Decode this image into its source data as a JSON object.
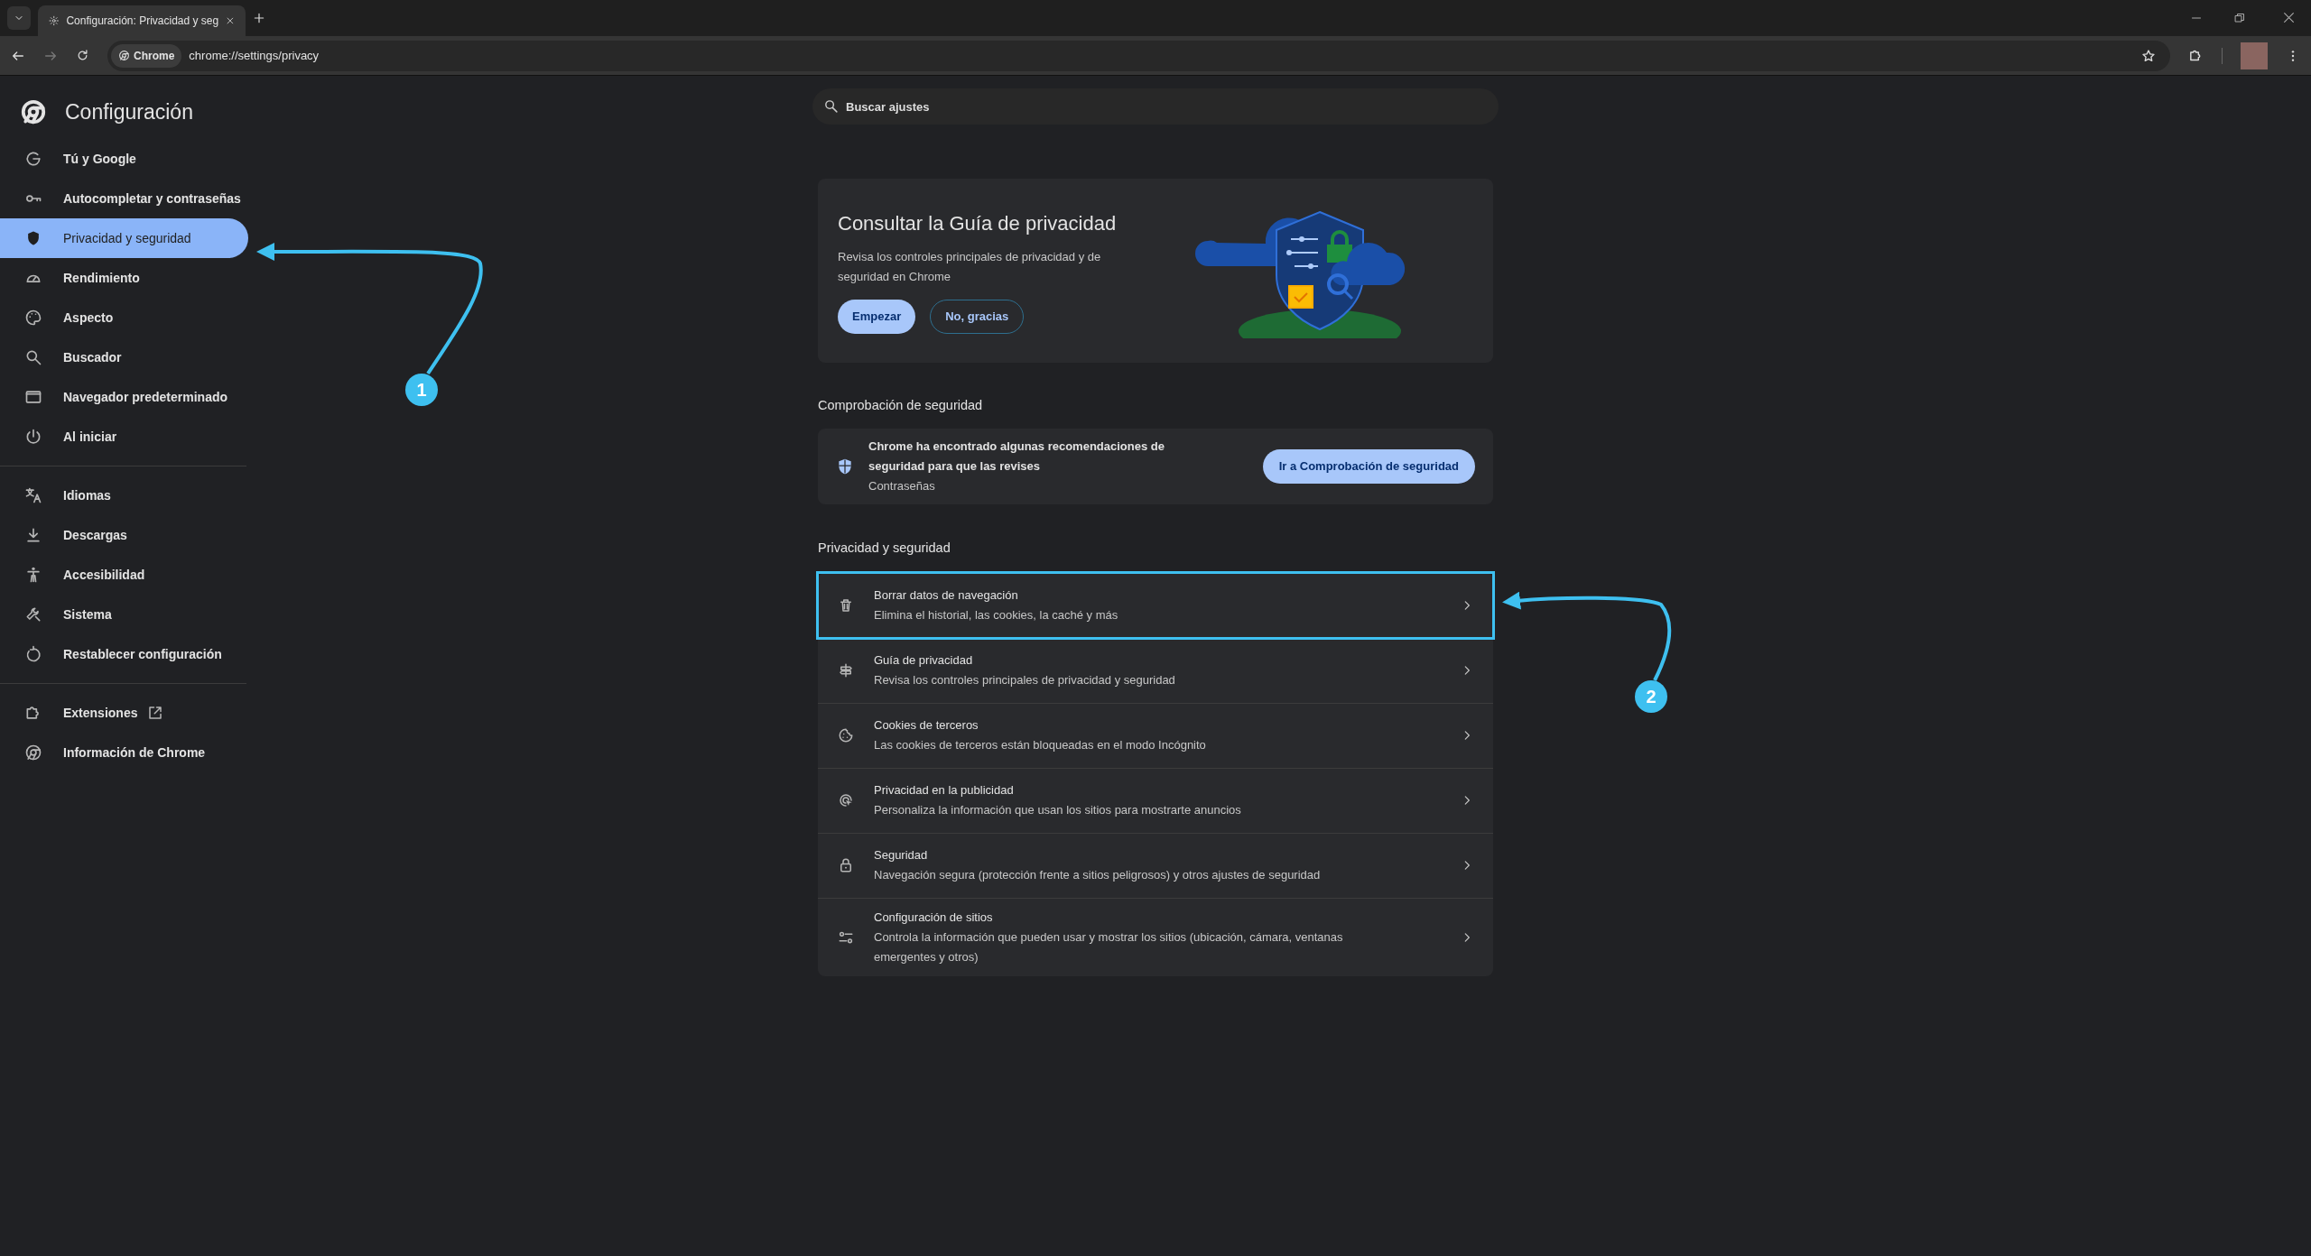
{
  "tab": {
    "title": "Configuración: Privacidad y seg",
    "selected": true
  },
  "toolbar": {
    "site_chip": "Chrome",
    "url": "chrome://settings/privacy"
  },
  "sidebar": {
    "title": "Configuración",
    "groups": [
      [
        {
          "label": "Tú y Google",
          "selected": false
        },
        {
          "label": "Autocompletar y contraseñas",
          "selected": false
        },
        {
          "label": "Privacidad y seguridad",
          "selected": true
        },
        {
          "label": "Rendimiento",
          "selected": false
        },
        {
          "label": "Aspecto",
          "selected": false
        },
        {
          "label": "Buscador",
          "selected": false
        },
        {
          "label": "Navegador predeterminado",
          "selected": false
        },
        {
          "label": "Al iniciar",
          "selected": false
        }
      ],
      [
        {
          "label": "Idiomas",
          "selected": false
        },
        {
          "label": "Descargas",
          "selected": false
        },
        {
          "label": "Accesibilidad",
          "selected": false
        },
        {
          "label": "Sistema",
          "selected": false
        },
        {
          "label": "Restablecer configuración",
          "selected": false
        }
      ],
      [
        {
          "label": "Extensiones",
          "selected": false
        },
        {
          "label": "Información de Chrome",
          "selected": false
        }
      ]
    ]
  },
  "search": {
    "placeholder": "Buscar ajustes"
  },
  "promo": {
    "title": "Consultar la Guía de privacidad",
    "text": "Revisa los controles principales de privacidad y de seguridad en Chrome",
    "primary": "Empezar",
    "secondary": "No, gracias"
  },
  "safety_check": {
    "heading": "Comprobación de seguridad",
    "message": "Chrome ha encontrado algunas recomendaciones de seguridad para que las revises",
    "detail": "Contraseñas",
    "button": "Ir a Comprobación de seguridad"
  },
  "privacy": {
    "heading": "Privacidad y seguridad",
    "rows": [
      {
        "title": "Borrar datos de navegación",
        "subtitle": "Elimina el historial, las cookies, la caché y más",
        "highlighted": true
      },
      {
        "title": "Guía de privacidad",
        "subtitle": "Revisa los controles principales de privacidad y seguridad",
        "highlighted": false
      },
      {
        "title": "Cookies de terceros",
        "subtitle": "Las cookies de terceros están bloqueadas en el modo Incógnito",
        "highlighted": false
      },
      {
        "title": "Privacidad en la publicidad",
        "subtitle": "Personaliza la información que usan los sitios para mostrarte anuncios",
        "highlighted": false
      },
      {
        "title": "Seguridad",
        "subtitle": "Navegación segura (protección frente a sitios peligrosos) y otros ajustes de seguridad",
        "highlighted": false
      },
      {
        "title": "Configuración de sitios",
        "subtitle": "Controla la información que pueden usar y mostrar los sitios (ubicación, cámara, ventanas emergentes y otros)",
        "highlighted": false
      }
    ]
  },
  "annotations": [
    {
      "label": "1"
    },
    {
      "label": "2"
    }
  ]
}
